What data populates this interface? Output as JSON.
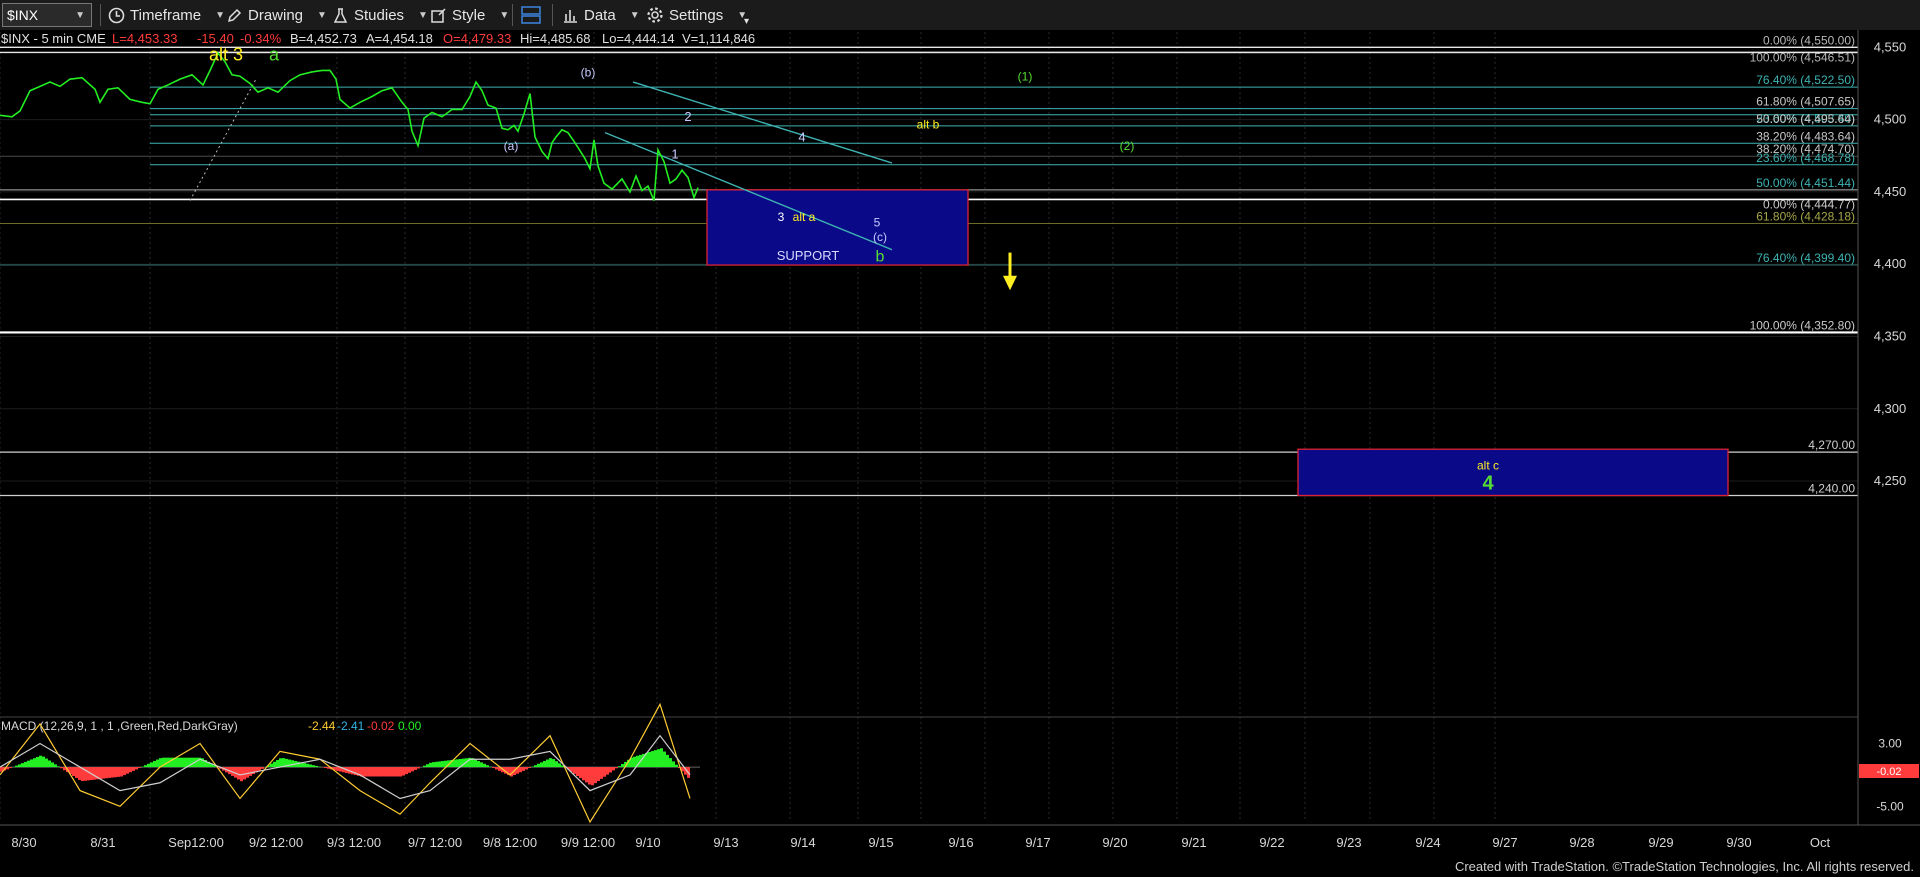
{
  "toolbar": {
    "symbol": "$INX",
    "timeframe": "Timeframe",
    "drawing": "Drawing",
    "studies": "Studies",
    "style": "Style",
    "data": "Data",
    "settings": "Settings"
  },
  "quote": {
    "symbol_line": "$INX - 5 min  CME",
    "last": "L=4,453.33",
    "change": "-15.40",
    "pct": "-0.34%",
    "bid": "B=4,452.73",
    "ask": "A=4,454.18",
    "open": "O=4,479.33",
    "high": "Hi=4,485.68",
    "low": "Lo=4,444.14",
    "volume": "V=1,114,846"
  },
  "colors": {
    "price": "#22ee22",
    "neg": "#ff3b3b",
    "fib": "#3fb3b3",
    "wave_yellow": "#ffee22",
    "wave_green": "#55dd33",
    "box_fill": "#0a0a88",
    "box_border": "#dd2233"
  },
  "chart_data": [
    {
      "type": "line",
      "y_axis": {
        "ylim": [
          4185,
          4562
        ],
        "ticks": [
          4550,
          4500,
          4450,
          4400,
          4350,
          4300,
          4250
        ],
        "tick_labels": [
          "4,550",
          "4,500",
          "4,450",
          "4,400",
          "4,350",
          "4,300",
          "4,250"
        ]
      },
      "x_axis": {
        "session_labels": [
          "8/30",
          "8/31",
          "Sep12:00",
          "9/2 12:00",
          "9/3 12:00",
          "9/7 12:00",
          "9/8 12:00",
          "9/9 12:00",
          "9/10",
          "9/13",
          "9/14",
          "9/15",
          "9/16",
          "9/17",
          "9/20",
          "9/21",
          "9/22",
          "9/23",
          "9/24",
          "9/27",
          "9/28",
          "9/29",
          "9/30",
          "Oct"
        ]
      },
      "series": [
        {
          "points": [
            [
              0,
              4503
            ],
            [
              12,
              4502
            ],
            [
              20,
              4506
            ],
            [
              30,
              4520
            ],
            [
              50,
              4526
            ],
            [
              60,
              4523
            ],
            [
              70,
              4528
            ],
            [
              82,
              4529
            ],
            [
              95,
              4521
            ],
            [
              100,
              4512
            ],
            [
              108,
              4521
            ],
            [
              118,
              4522
            ],
            [
              130,
              4514
            ],
            [
              142,
              4512
            ],
            [
              150,
              4511
            ],
            [
              158,
              4521
            ],
            [
              168,
              4524
            ],
            [
              180,
              4528
            ],
            [
              192,
              4531
            ],
            [
              203,
              4524
            ],
            [
              210,
              4534
            ],
            [
              218,
              4546
            ],
            [
              225,
              4540
            ],
            [
              232,
              4531
            ],
            [
              240,
              4530
            ],
            [
              250,
              4525
            ],
            [
              258,
              4519
            ],
            [
              268,
              4522
            ],
            [
              278,
              4519
            ],
            [
              290,
              4527
            ],
            [
              300,
              4531
            ],
            [
              312,
              4533
            ],
            [
              322,
              4534
            ],
            [
              330,
              4534
            ],
            [
              336,
              4528
            ],
            [
              340,
              4514
            ],
            [
              350,
              4508
            ],
            [
              360,
              4512
            ],
            [
              372,
              4516
            ],
            [
              382,
              4520
            ],
            [
              392,
              4522
            ],
            [
              402,
              4512
            ],
            [
              408,
              4507
            ],
            [
              412,
              4492
            ],
            [
              418,
              4482
            ],
            [
              424,
              4501
            ],
            [
              432,
              4505
            ],
            [
              442,
              4502
            ],
            [
              452,
              4507
            ],
            [
              462,
              4507
            ],
            [
              470,
              4516
            ],
            [
              476,
              4526
            ],
            [
              482,
              4520
            ],
            [
              488,
              4510
            ],
            [
              496,
              4508
            ],
            [
              502,
              4494
            ],
            [
              508,
              4493
            ],
            [
              514,
              4496
            ],
            [
              518,
              4492
            ],
            [
              524,
              4504
            ],
            [
              530,
              4518
            ],
            [
              535,
              4488
            ],
            [
              542,
              4478
            ],
            [
              548,
              4473
            ],
            [
              552,
              4484
            ],
            [
              556,
              4488
            ],
            [
              562,
              4493
            ],
            [
              568,
              4491
            ],
            [
              575,
              4484
            ],
            [
              585,
              4473
            ],
            [
              590,
              4466
            ],
            [
              594,
              4486
            ],
            [
              598,
              4468
            ],
            [
              604,
              4456
            ],
            [
              612,
              4452
            ],
            [
              622,
              4459
            ],
            [
              630,
              4450
            ],
            [
              636,
              4461
            ],
            [
              642,
              4451
            ],
            [
              648,
              4454
            ],
            [
              654,
              4444
            ],
            [
              658,
              4479
            ],
            [
              664,
              4471
            ],
            [
              670,
              4456
            ],
            [
              676,
              4459
            ],
            [
              682,
              4465
            ],
            [
              688,
              4460
            ],
            [
              694,
              4446
            ],
            [
              698,
              4453
            ]
          ]
        }
      ],
      "fib_levels": [
        {
          "label": "0.00% (4,550.00)",
          "value": 4550
        },
        {
          "label": "100.00% (4,546.51)",
          "value": 4546.51
        },
        {
          "label": "76.40% (4,522.50)",
          "value": 4522.5
        },
        {
          "label": "61.80% (4,507.65)",
          "value": 4507.65
        },
        {
          "label": "23.60% (4,503.40)",
          "value": 4503.4
        },
        {
          "label": "50.00% (4,495.64)",
          "value": 4495.64
        },
        {
          "label": "38.20% (4,483.64)",
          "value": 4483.64
        },
        {
          "label": "38.20% (4,474.70)",
          "value": 4474.7
        },
        {
          "label": "23.60% (4,468.78)",
          "value": 4468.78
        },
        {
          "label": "50.00% (4,451.44)",
          "value": 4451.44
        },
        {
          "label": "0.00% (4,444.77)",
          "value": 4444.77
        },
        {
          "label": "61.80% (4,428.18)",
          "value": 4428.18
        },
        {
          "label": "76.40% (4,399.40)",
          "value": 4399.4
        },
        {
          "label": "100.00% (4,352.80)",
          "value": 4352.8
        },
        {
          "label": "4,270.00",
          "value": 4270
        },
        {
          "label": "4,240.00",
          "value": 4240
        }
      ],
      "last_price_label": "4,453.33",
      "support_box": {
        "top": 4451.44,
        "bottom": 4399.4,
        "label": "SUPPORT"
      },
      "target_box": {
        "top": 4272,
        "bottom": 4240,
        "label_alt": "alt c",
        "label_wave": "4"
      },
      "wave_labels": {
        "alt3": "alt 3",
        "a": "a",
        "wa": "(a)",
        "wb": "(b)",
        "w1": "1",
        "w2": "2",
        "w3": "3",
        "alta": "alt a",
        "w4": "4",
        "w5": "5",
        "wc": "(c)",
        "b": "b",
        "altb": "alt b",
        "p1": "(1)",
        "p2": "(2)"
      }
    },
    {
      "type": "line",
      "title": "MACD (12,26,9, 1 , 1 ,Green,Red,DarkGray)",
      "values_text": [
        "-2.44",
        "-2.41",
        "-0.02",
        "0.00"
      ],
      "ylim": [
        -7,
        6
      ],
      "ticks": [
        3,
        -5
      ],
      "tick_labels": [
        "3.00",
        "-5.00"
      ],
      "last_label": "-0.02",
      "series": [
        {
          "name": "MACD",
          "points": [
            [
              0,
              -1
            ],
            [
              40,
              5.5
            ],
            [
              80,
              -3
            ],
            [
              120,
              -5
            ],
            [
              160,
              0
            ],
            [
              200,
              3
            ],
            [
              240,
              -4
            ],
            [
              280,
              2
            ],
            [
              320,
              1
            ],
            [
              360,
              -3
            ],
            [
              400,
              -6
            ],
            [
              430,
              -2
            ],
            [
              470,
              3
            ],
            [
              510,
              -1
            ],
            [
              550,
              4
            ],
            [
              590,
              -7
            ],
            [
              630,
              1
            ],
            [
              660,
              8
            ],
            [
              690,
              -4
            ]
          ]
        },
        {
          "name": "Signal",
          "points": [
            [
              0,
              0
            ],
            [
              40,
              3
            ],
            [
              80,
              0
            ],
            [
              120,
              -3
            ],
            [
              160,
              -2
            ],
            [
              200,
              1
            ],
            [
              240,
              -1
            ],
            [
              280,
              0
            ],
            [
              320,
              1
            ],
            [
              360,
              -1
            ],
            [
              400,
              -4
            ],
            [
              430,
              -3
            ],
            [
              470,
              1
            ],
            [
              510,
              1
            ],
            [
              550,
              2
            ],
            [
              590,
              -3
            ],
            [
              630,
              -1
            ],
            [
              660,
              4
            ],
            [
              690,
              -1
            ]
          ]
        }
      ]
    }
  ],
  "footer": "Created with TradeStation. ©TradeStation Technologies, Inc. All rights reserved."
}
